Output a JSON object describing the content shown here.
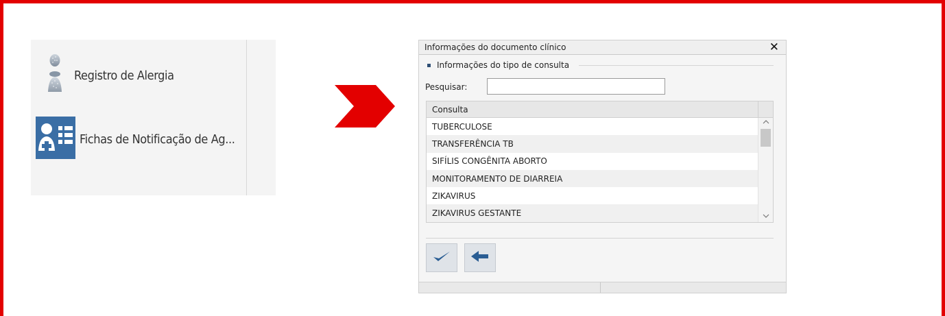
{
  "menu": {
    "items": [
      {
        "label": "Registro de Alergia",
        "icon": "allergy-person-icon"
      },
      {
        "label": "Fichas de Notificação de Ag...",
        "icon": "notification-form-icon"
      }
    ]
  },
  "arrow": {
    "icon": "chevron-right-icon",
    "color": "#e30000"
  },
  "dialog": {
    "title": "Informações do documento clínico",
    "close_label": "✕",
    "section_label": "Informações do tipo de consulta",
    "search_label": "Pesquisar:",
    "search_value": "",
    "grid": {
      "column_header": "Consulta",
      "rows": [
        "TUBERCULOSE",
        "TRANSFERÊNCIA TB",
        "SIFÍLIS CONGÊNITA ABORTO",
        "MONITORAMENTO DE DIARREIA",
        "ZIKAVIRUS",
        "ZIKAVIRUS GESTANTE"
      ]
    },
    "buttons": {
      "confirm_icon": "checkmark-icon",
      "back_icon": "back-arrow-icon"
    }
  },
  "colors": {
    "frame": "#e30000",
    "icon_blue": "#3a6ea5",
    "button_blue": "#2a5d93"
  }
}
